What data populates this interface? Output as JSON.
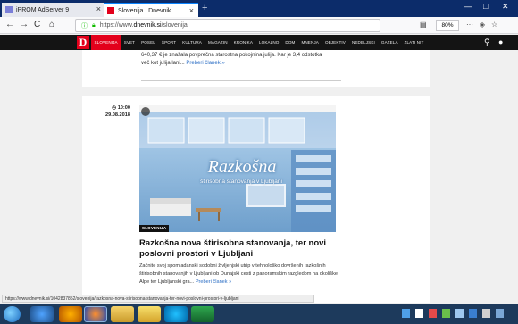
{
  "browser": {
    "tabs": [
      {
        "label": "iPROM AdServer 9",
        "close": "×"
      },
      {
        "label": "Slovenija | Dnevnik",
        "close": "×"
      }
    ],
    "new_tab": "+",
    "window_controls": {
      "minimize": "—",
      "maximize": "□",
      "close": "✕"
    },
    "nav": {
      "back": "←",
      "forward": "→",
      "reload": "C",
      "home": "⌂"
    },
    "url": {
      "prefix": "https://www.",
      "host": "dnevnik.si",
      "path": "/slovenija"
    },
    "zoom": "80%",
    "menu_dots": "···",
    "star": "☆"
  },
  "site": {
    "logo": "D",
    "menu": [
      "SLOVENIJA",
      "SVET",
      "POSEL",
      "ŠPORT",
      "KULTURA",
      "MAGAZIN",
      "KRONIKA",
      "LOKALNO",
      "DOM",
      "MNENJA",
      "OBJEKTIV",
      "NEDELJSKI",
      "GAZELA",
      "ZLATI NIT"
    ],
    "active_menu": "SLOVENIJA",
    "search_icon": "⚲",
    "user_icon": "●"
  },
  "previous_article": {
    "excerpt_line1": "640,37 € je znašala povprečna starostna pokojnina julija. Kar je 3,4 odstotka",
    "excerpt_line2": "več kot julija lani...",
    "more": "Preberi članek »"
  },
  "article": {
    "time": "10:00",
    "date": "29.08.2018",
    "category": "SLOVENIJA",
    "image_title": "Razkošna",
    "image_subtitle": "štirisobna stanovanja v Ljubljani",
    "title": "Razkošna nova štirisobna stanovanja, ter novi poslovni prostori v Ljubljani",
    "excerpt": "Začnite svoj spomladanski sodobni življenjski utrip v tehnološko dovršenih razkošnih štirisobnih stanovanjih v Ljubljani ob Dunajski cesti z panoramskim razgledom na okoliške Alpe ter Ljubljanski gra...",
    "more": "Preberi članek »"
  },
  "status_url": "https://www.dnevnik.si/1042837852/slovenija/razkosna-nova-stirisobna-stanovanja-ter-novi-poslovni-prostori-v-ljubljani",
  "colors": {
    "accent": "#e3001b",
    "header": "#141414",
    "link": "#2d6fc5",
    "tabbar": "#0c2c6a"
  }
}
